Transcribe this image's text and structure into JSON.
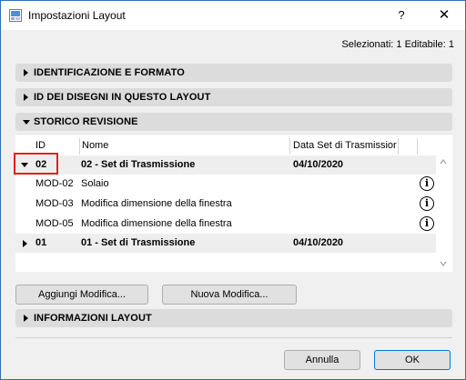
{
  "window": {
    "title": "Impostazioni Layout",
    "help_label": "?",
    "close_label": "✕"
  },
  "selection_info": "Selezionati: 1 Editabile: 1",
  "sections": {
    "identification": "IDENTIFICAZIONE E FORMATO",
    "drawing_ids": "ID DEI DISEGNI IN QUESTO LAYOUT",
    "revision_history": "STORICO REVISIONE",
    "layout_info": "INFORMAZIONI LAYOUT"
  },
  "table": {
    "columns": [
      "ID",
      "Nome",
      "Data Set di Trasmissior"
    ],
    "rows": [
      {
        "type": "group",
        "id": "02",
        "name": "02 - Set di Trasmissione",
        "date": "04/10/2020",
        "expanded": true
      },
      {
        "type": "item",
        "id": "MOD-02",
        "name": "Solaio",
        "info": "i"
      },
      {
        "type": "item",
        "id": "MOD-03",
        "name": "Modifica dimensione della finestra",
        "info": "i"
      },
      {
        "type": "item",
        "id": "MOD-05",
        "name": "Modifica dimensione della finestra",
        "info": "i"
      },
      {
        "type": "group",
        "id": "01",
        "name": "01 - Set di Trasmissione",
        "date": "04/10/2020",
        "expanded": false
      }
    ]
  },
  "buttons": {
    "add_change": "Aggiungi Modifica...",
    "new_change": "Nuova Modifica...",
    "cancel": "Annulla",
    "ok": "OK"
  },
  "colors": {
    "highlight": "#e02020",
    "titlebar_border": "#2a6fb8",
    "primary_border": "#0078d7"
  }
}
